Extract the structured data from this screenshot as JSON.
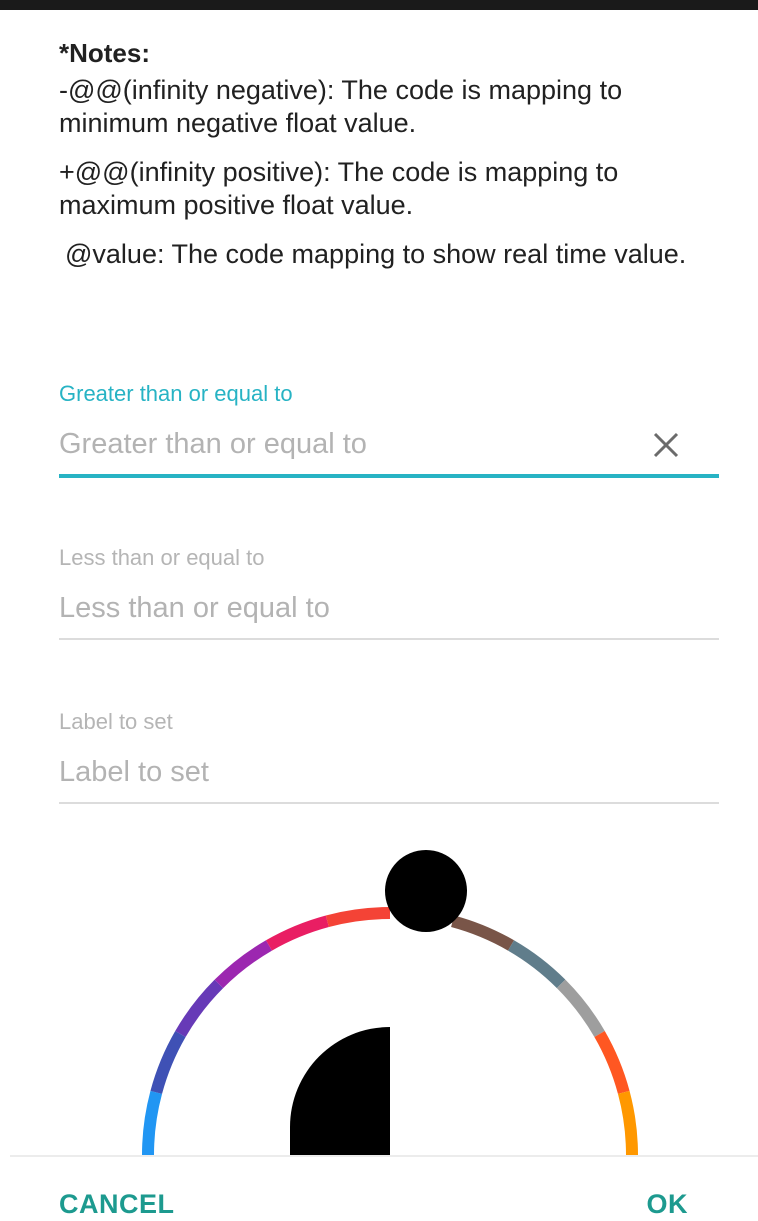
{
  "notes": {
    "title": "*Notes:",
    "items": [
      "-@@(infinity negative): The code is mapping to minimum negative float value.",
      "+@@(infinity positive): The code is mapping to maximum positive float value.",
      "@value: The code mapping to show real time value."
    ]
  },
  "fields": {
    "greater": {
      "label": "Greater than or equal to",
      "placeholder": "Greater than or equal to",
      "value": ""
    },
    "less": {
      "label": "Less than or equal to",
      "placeholder": "Less than or equal to",
      "value": ""
    },
    "label_to_set": {
      "label": "Label to set",
      "placeholder": "Label to set",
      "value": ""
    }
  },
  "color_wheel": {
    "segment_colors": [
      "#2196f3",
      "#3f51b5",
      "#673ab7",
      "#9c27b0",
      "#e91e63",
      "#f44336",
      "#000000",
      "#795548",
      "#607d8b",
      "#9e9e9e",
      "#ff5722",
      "#ff9800"
    ],
    "selected_color": "#000000"
  },
  "actions": {
    "cancel": "CANCEL",
    "ok": "OK"
  },
  "colors": {
    "accent": "#27b3c4",
    "button_text": "#1d9a8f"
  }
}
